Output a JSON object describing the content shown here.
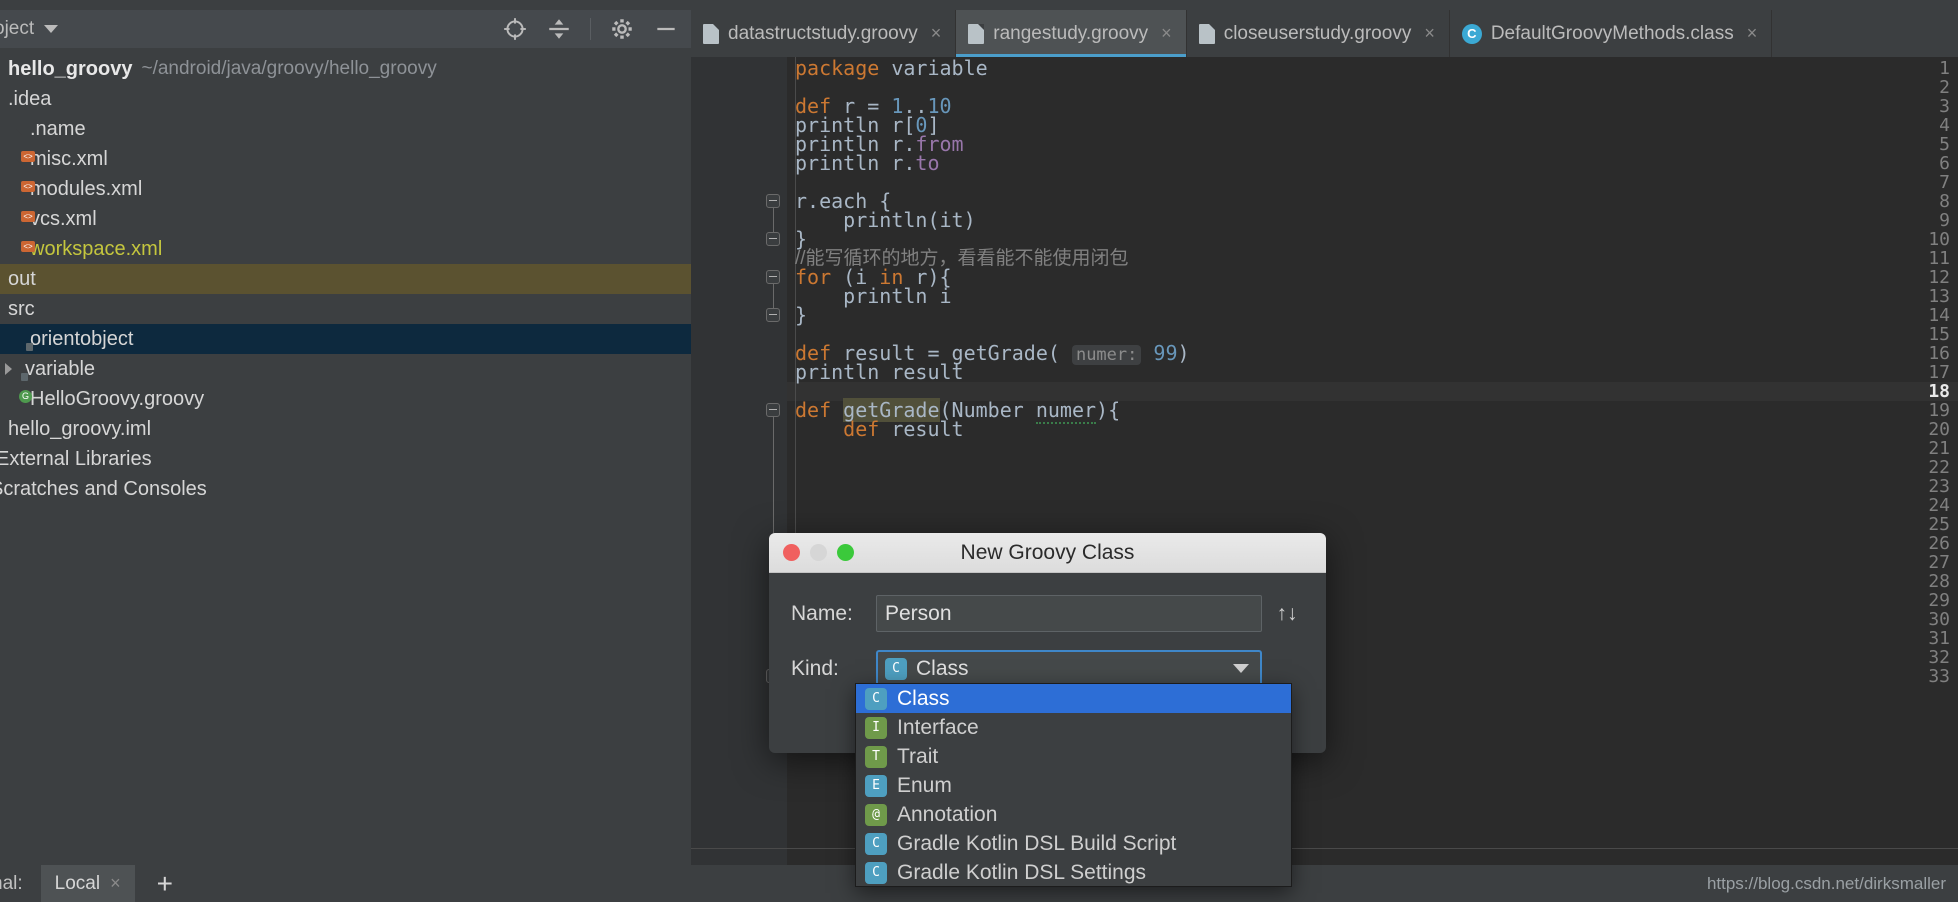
{
  "project_panel": {
    "title": "oject",
    "tools": [
      {
        "name": "locate-icon",
        "label": "Select Opened File"
      },
      {
        "name": "collapse-all-icon",
        "label": "Collapse All"
      },
      {
        "name": "gear-icon",
        "label": "Settings"
      },
      {
        "name": "minimize-icon",
        "label": "Hide"
      }
    ],
    "tree": [
      {
        "label": "hello_groovy",
        "path": "~/android/java/groovy/hello_groovy",
        "icon": "project-icon",
        "indent": 0,
        "bold": true,
        "arrow": false,
        "state": "none"
      },
      {
        "label": ".idea",
        "icon": "folder-blue",
        "indent": 0,
        "bold": false,
        "arrow": false,
        "state": "none"
      },
      {
        "label": ".name",
        "icon": "file-plain",
        "indent": 1,
        "bold": false,
        "arrow": false,
        "state": "none"
      },
      {
        "label": "misc.xml",
        "icon": "file-xml",
        "indent": 1,
        "bold": false,
        "arrow": false,
        "state": "none"
      },
      {
        "label": "modules.xml",
        "icon": "file-xml",
        "indent": 1,
        "bold": false,
        "arrow": false,
        "state": "none"
      },
      {
        "label": "vcs.xml",
        "icon": "file-xml",
        "indent": 1,
        "bold": false,
        "arrow": false,
        "state": "none"
      },
      {
        "label": "workspace.xml",
        "icon": "file-xml",
        "indent": 1,
        "bold": false,
        "arrow": false,
        "state": "modified"
      },
      {
        "label": "out",
        "icon": "folder-orange",
        "indent": 0,
        "bold": false,
        "arrow": false,
        "state": "olive"
      },
      {
        "label": "src",
        "icon": "folder-blue",
        "indent": 0,
        "bold": false,
        "arrow": false,
        "state": "none"
      },
      {
        "label": "orientobject",
        "icon": "folder-package",
        "indent": 1,
        "bold": false,
        "arrow": false,
        "state": "selected"
      },
      {
        "label": "variable",
        "icon": "folder-package",
        "indent": 1,
        "bold": false,
        "arrow": true,
        "state": "none"
      },
      {
        "label": "HelloGroovy.groovy",
        "icon": "file-groovy",
        "indent": 1,
        "bold": false,
        "arrow": false,
        "state": "none"
      },
      {
        "label": "hello_groovy.iml",
        "icon": "file-iml",
        "indent": 0,
        "bold": false,
        "arrow": false,
        "state": "none"
      },
      {
        "label": "External Libraries",
        "icon": "library-icon",
        "indent": 0,
        "bold": false,
        "arrow": false,
        "state": "none"
      },
      {
        "label": "Scratches and Consoles",
        "icon": "scratch-icon",
        "indent": 0,
        "bold": false,
        "arrow": false,
        "state": "none"
      }
    ]
  },
  "editor": {
    "tabs": [
      {
        "label": "datastructstudy.groovy",
        "icon": "groovy-file-icon",
        "active": false,
        "close": "×"
      },
      {
        "label": "rangestudy.groovy",
        "icon": "groovy-file-icon",
        "active": true,
        "close": "×"
      },
      {
        "label": "closeuserstudy.groovy",
        "icon": "groovy-file-icon",
        "active": false,
        "close": "×"
      },
      {
        "label": "DefaultGroovyMethods.class",
        "icon": "class-file-icon",
        "active": false,
        "close": "×"
      }
    ],
    "line_numbers": [
      1,
      2,
      3,
      4,
      5,
      6,
      7,
      8,
      9,
      10,
      11,
      12,
      13,
      14,
      15,
      16,
      17,
      18,
      19,
      20,
      21,
      22,
      23,
      24,
      25,
      26,
      27,
      28,
      29,
      30,
      31,
      32,
      33
    ],
    "current_line": 18,
    "code_lines": [
      {
        "n": 1,
        "text": "package variable"
      },
      {
        "n": 2,
        "text": ""
      },
      {
        "n": 3,
        "text": "def r = 1..10"
      },
      {
        "n": 4,
        "text": "println r[0]"
      },
      {
        "n": 5,
        "text": "println r.from"
      },
      {
        "n": 6,
        "text": "println r.to"
      },
      {
        "n": 7,
        "text": ""
      },
      {
        "n": 8,
        "text": "r.each {"
      },
      {
        "n": 9,
        "text": "    println(it)"
      },
      {
        "n": 10,
        "text": "}"
      },
      {
        "n": 11,
        "text": "//能写循环的地方，看看能不能使用闭包"
      },
      {
        "n": 12,
        "text": "for (i in r){"
      },
      {
        "n": 13,
        "text": "    println i"
      },
      {
        "n": 14,
        "text": "}"
      },
      {
        "n": 15,
        "text": ""
      },
      {
        "n": 16,
        "text": "def result = getGrade( numer: 99)"
      },
      {
        "n": 17,
        "text": "println result"
      },
      {
        "n": 18,
        "text": ""
      },
      {
        "n": 19,
        "text": "def getGrade(Number numer){"
      },
      {
        "n": 20,
        "text": "    def result"
      },
      {
        "n": 31,
        "text": "    }"
      },
      {
        "n": 33,
        "text": "}"
      }
    ],
    "param_hint": "numer:",
    "param_value": "99"
  },
  "dialog": {
    "title": "New Groovy Class",
    "traffic_lights": [
      "close",
      "minimize",
      "zoom"
    ],
    "name_label": "Name:",
    "name_value": "Person",
    "name_placeholder": "",
    "swap_icon": "↑↓",
    "kind_label": "Kind:",
    "kind_value": "Class",
    "dropdown_open": true,
    "kind_options": [
      {
        "label": "Class",
        "badge": "C",
        "badge_class": "k-class",
        "selected": true
      },
      {
        "label": "Interface",
        "badge": "I",
        "badge_class": "k-interface",
        "selected": false
      },
      {
        "label": "Trait",
        "badge": "T",
        "badge_class": "k-trait",
        "selected": false
      },
      {
        "label": "Enum",
        "badge": "E",
        "badge_class": "k-enum",
        "selected": false
      },
      {
        "label": "Annotation",
        "badge": "@",
        "badge_class": "k-annotation",
        "selected": false
      },
      {
        "label": "Gradle Kotlin DSL Build Script",
        "badge": "C",
        "badge_class": "k-class",
        "selected": false
      },
      {
        "label": "Gradle Kotlin DSL Settings",
        "badge": "C",
        "badge_class": "k-class",
        "selected": false
      }
    ]
  },
  "bottom": {
    "terminal_label": "nal:",
    "tab_label": "Local",
    "tab_close": "×",
    "add_label": "+",
    "watermark": "https://blog.csdn.net/dirksmaller"
  },
  "colors": {
    "accent": "#4b9ecb",
    "selection_blue": "#2d6ed6",
    "keyword_orange": "#cc7832",
    "number_blue": "#6897bb",
    "panel_bg": "#3c3f41",
    "editor_bg": "#2b2b2b"
  }
}
